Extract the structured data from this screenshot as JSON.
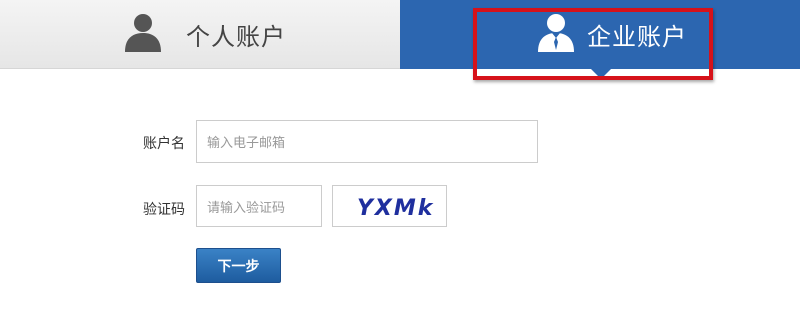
{
  "tabs": {
    "personal": {
      "label": "个人账户",
      "icon": "user-icon"
    },
    "enterprise": {
      "label": "企业账户",
      "icon": "business-user-icon",
      "active": true
    }
  },
  "form": {
    "account": {
      "label": "账户名",
      "placeholder": "输入电子邮箱"
    },
    "captcha": {
      "label": "验证码",
      "placeholder": "请输入验证码",
      "code": "YXMk"
    },
    "next_button": "下一步"
  },
  "colors": {
    "accent": "#2c66b0",
    "highlight": "#d6121a",
    "button": "#1e5c9f"
  }
}
